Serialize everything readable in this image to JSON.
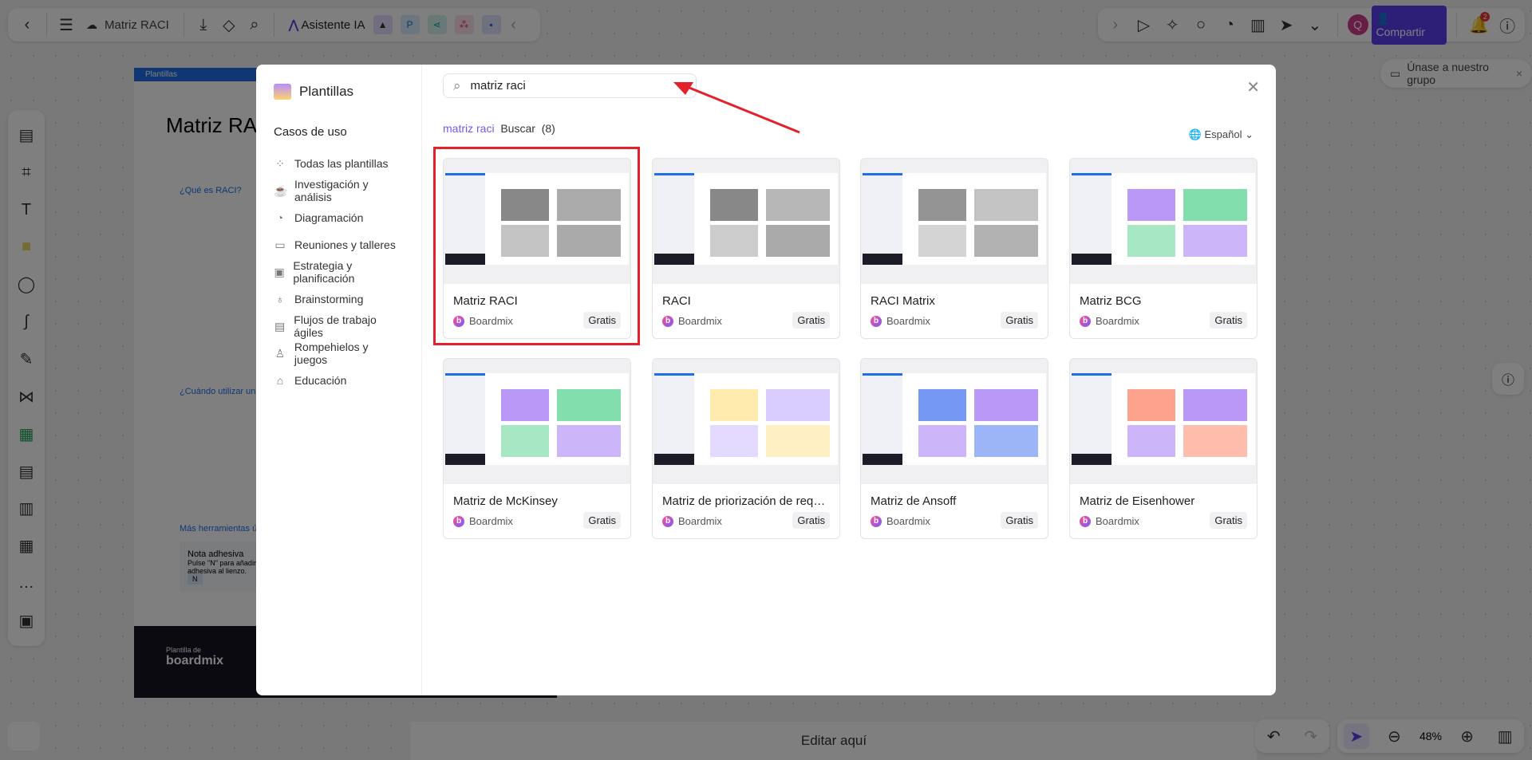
{
  "toolbar": {
    "title": "Matriz RACI",
    "ai_label": "Asistente IA",
    "share_label": "Compartir",
    "avatar": "Q",
    "notif_count": "2"
  },
  "join_group": "Únase a nuestro grupo",
  "canvas": {
    "doc_tab": "Plantillas",
    "doc_title": "Matriz RACI",
    "q1": "¿Qué es RACI?",
    "q2": "¿Cuándo utilizar una",
    "more": "Más herramientas ú",
    "note_title": "Nota adhesiva",
    "note_text": "Pulse \"N\" para añadir rápidamente una nota adhesiva al lienzo.",
    "note_key": "N",
    "footer_small": "Plantilla de",
    "footer_brand": "boardmix"
  },
  "bottom": {
    "edit_here": "Editar aquí",
    "zoom": "48%"
  },
  "modal": {
    "title": "Plantillas",
    "section": "Casos de uso",
    "categories": [
      {
        "label": "Todas las plantillas",
        "icon": "grid-icon"
      },
      {
        "label": "Investigación y análisis",
        "icon": "cup-icon"
      },
      {
        "label": "Diagramación",
        "icon": "pie-icon"
      },
      {
        "label": "Reuniones y talleres",
        "icon": "board-icon"
      },
      {
        "label": "Estrategia y planificación",
        "icon": "briefcase-icon"
      },
      {
        "label": "Brainstorming",
        "icon": "bulb-icon"
      },
      {
        "label": "Flujos de trabajo ágiles",
        "icon": "clipboard-icon"
      },
      {
        "label": "Rompehielos y juegos",
        "icon": "people-icon"
      },
      {
        "label": "Educación",
        "icon": "cap-icon"
      }
    ],
    "search_value": "matriz raci",
    "search_query": "matriz raci",
    "search_label": "Buscar",
    "result_count": "(8)",
    "language": "Español",
    "cards": [
      {
        "title": "Matriz RACI",
        "author": "Boardmix",
        "badge": "Gratis"
      },
      {
        "title": "RACI",
        "author": "Boardmix",
        "badge": "Gratis"
      },
      {
        "title": "RACI Matrix",
        "author": "Boardmix",
        "badge": "Gratis"
      },
      {
        "title": "Matriz BCG",
        "author": "Boardmix",
        "badge": "Gratis"
      },
      {
        "title": "Matriz de McKinsey",
        "author": "Boardmix",
        "badge": "Gratis"
      },
      {
        "title": "Matriz de priorización de requisitos",
        "author": "Boardmix",
        "badge": "Gratis"
      },
      {
        "title": "Matriz de Ansoff",
        "author": "Boardmix",
        "badge": "Gratis"
      },
      {
        "title": "Matriz de Eisenhower",
        "author": "Boardmix",
        "badge": "Gratis"
      }
    ]
  },
  "colors": {
    "accent": "#6c5ce7",
    "share": "#5b3cf0",
    "highlight": "#e5202b"
  }
}
